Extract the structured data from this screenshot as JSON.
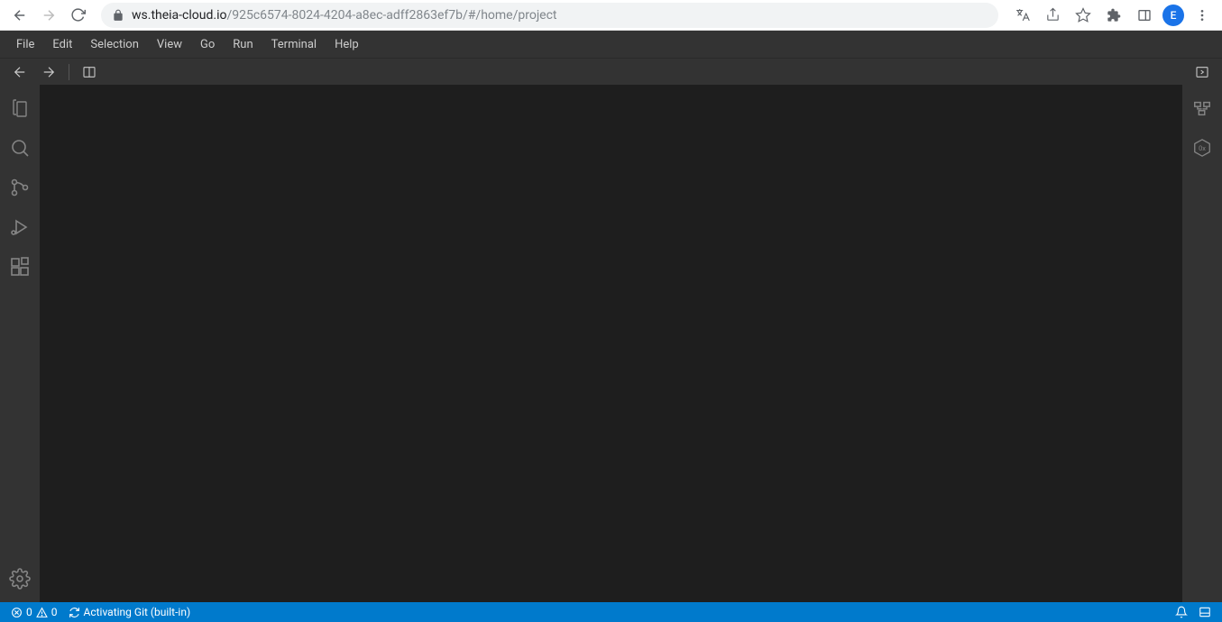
{
  "browser": {
    "url_host": "ws.theia-cloud.io",
    "url_path": "/925c6574-8024-4204-a8ec-adff2863ef7b/#/home/project",
    "avatar_letter": "E"
  },
  "menu": {
    "items": [
      "File",
      "Edit",
      "Selection",
      "View",
      "Go",
      "Run",
      "Terminal",
      "Help"
    ]
  },
  "status": {
    "errors": "0",
    "warnings": "0",
    "git_message": "Activating Git (built-in)"
  }
}
